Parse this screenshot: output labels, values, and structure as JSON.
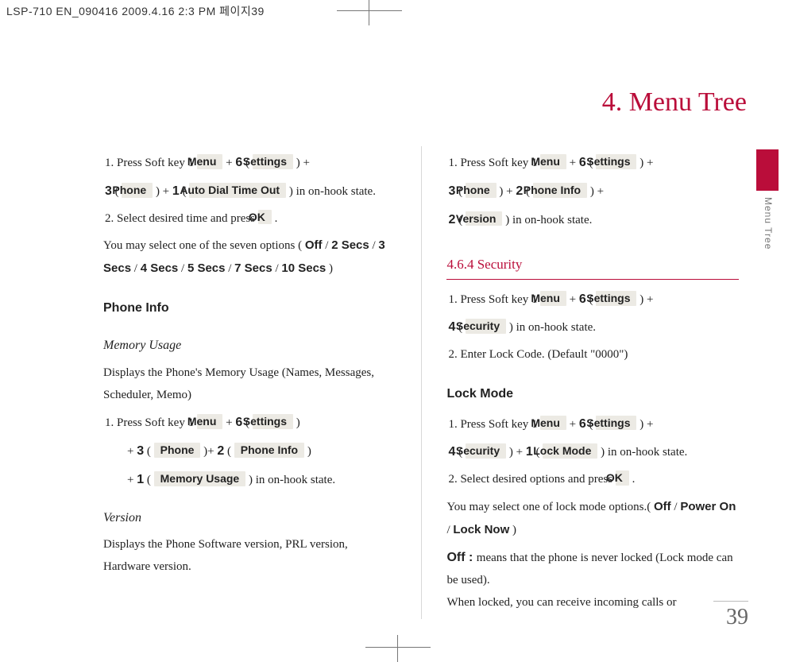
{
  "header": "LSP-710 EN_090416  2009.4.16 2:3 PM  페이지39",
  "title": "4. Menu Tree",
  "side_label": "Menu Tree",
  "page_number": "39",
  "keys": {
    "menu": "Menu",
    "ok": "OK",
    "settings": "Settings",
    "phone": "Phone",
    "auto_dial": "Auto Dial Time Out",
    "phone_info": "Phone Info",
    "memory_usage": "Memory Usage",
    "version": "Version",
    "security": "Security",
    "lock_mode": "Lock Mode",
    "off": "Off",
    "secs2": "2 Secs",
    "secs3": "3 Secs",
    "secs4": "4 Secs",
    "secs5": "5 Secs",
    "secs7": "7 Secs",
    "secs10": "10 Secs",
    "power_on": "Power On",
    "lock_now": "Lock Now",
    "d1": "1",
    "d2": "2",
    "d3": "3",
    "d4": "4",
    "d6": "6"
  },
  "left": {
    "step1_a": "1. Press Soft key 1 ",
    "step1_onhook": " in on-hook state.",
    "step2": "2.  Select desired time and press ",
    "opts_intro": "You may select one of the seven options ( ",
    "phone_info_h": "Phone Info",
    "mem_h": "Memory Usage",
    "mem_body": "Displays the Phone's Memory Usage (Names, Messages, Scheduler, Memo)",
    "mem_step1": "1. Press Soft key 1 ",
    "mem_onhook": " ) in on-hook state.",
    "ver_h": "Version",
    "ver_body": "Displays the Phone Software version, PRL version, Hardware version."
  },
  "right": {
    "step1": "1. Press Soft key 1 ",
    "onhook": " ) in on-hook state.",
    "sec_h": "4.6.4 Security",
    "sec_step1": "1. Press Soft key 1 ",
    "sec_onhook": " ) in on-hook state.",
    "sec_step2": "2. Enter Lock Code. (Default \"0000\")",
    "lock_h": "Lock Mode",
    "lock_step1": "1. Press Soft key 1 ",
    "lock_onhook": " ) in on-hook state.",
    "lock_step2": "2. Select desired options and press ",
    "lock_opts": "You may select one of lock mode options.( ",
    "off_label": "Off : ",
    "off_body": "means that the phone is never locked (Lock mode can be used).",
    "off_body2": "When locked, you can receive incoming calls or"
  }
}
